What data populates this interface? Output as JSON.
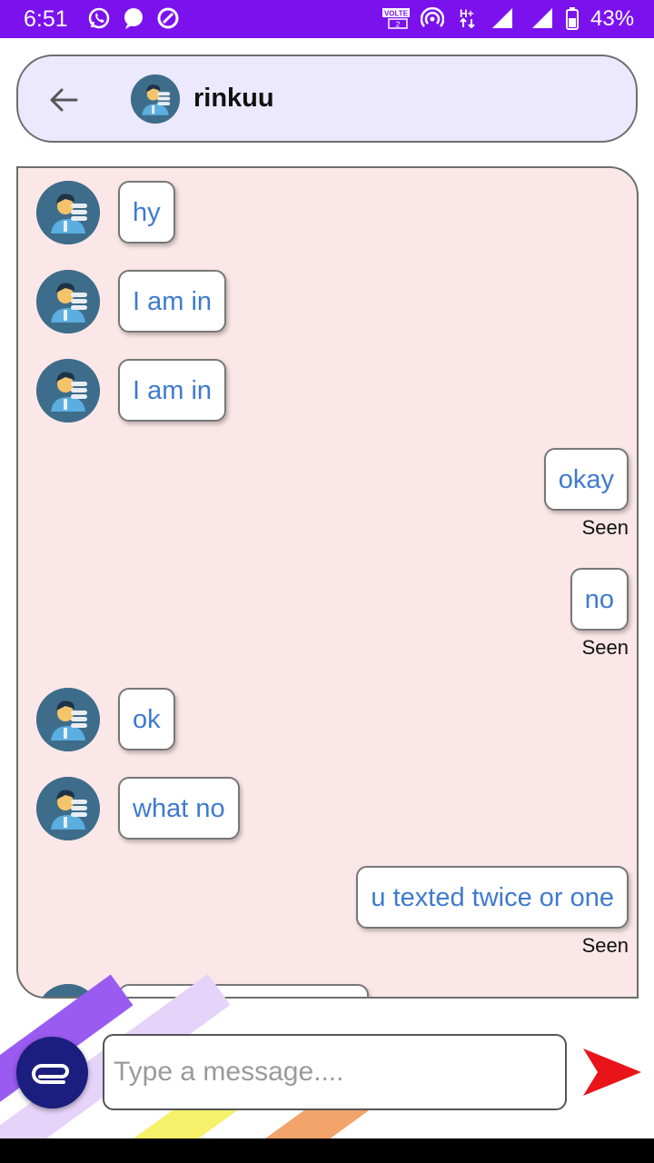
{
  "status_bar": {
    "time": "6:51",
    "battery": "43%",
    "volte_label": "VOLTE",
    "sim_label": "2",
    "network_label": "H+",
    "color": "#7b12ee"
  },
  "header": {
    "contact_name": "rinkuu",
    "icons": {
      "back": "arrow-left-icon",
      "avatar": "person-avatar-icon"
    }
  },
  "messages": [
    {
      "direction": "in",
      "text": "hy"
    },
    {
      "direction": "in",
      "text": "I am in"
    },
    {
      "direction": "in",
      "text": "I am in"
    },
    {
      "direction": "out",
      "text": "okay",
      "status": "Seen"
    },
    {
      "direction": "out",
      "text": "no",
      "status": "Seen"
    },
    {
      "direction": "in",
      "text": "ok"
    },
    {
      "direction": "in",
      "text": "what no"
    },
    {
      "direction": "out",
      "text": "u texted twice or one",
      "status": "Seen"
    }
  ],
  "composer": {
    "placeholder": "Type a message....",
    "value": "",
    "icons": {
      "attach": "paperclip-icon",
      "send": "send-arrow-icon"
    }
  },
  "colors": {
    "accent": "#7b12ee",
    "chat_background": "#fbe7e7",
    "header_background": "#ece8fd",
    "message_text": "#3f7ad0",
    "send_arrow": "#e8141a",
    "attach_button": "#1b1e7e"
  }
}
